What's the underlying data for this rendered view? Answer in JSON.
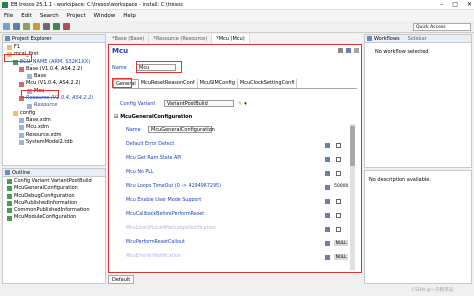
{
  "window": {
    "title": "EB tresos 25.1.1 - workspace: C:\\tresos\\workspace - install: C:\\tresos",
    "min": "–",
    "max": "□",
    "close": "✕"
  },
  "menu": [
    "File",
    "Edit",
    "Search",
    "Project",
    "Window",
    "Help"
  ],
  "quick_access": "Quick Access",
  "project_explorer": {
    "tab": "Project Explorer",
    "items": [
      {
        "label": "F1"
      },
      {
        "label": "mcal_first"
      },
      {
        "label": "ECU_NAME (ARM, S32K1XX)"
      },
      {
        "label": "Base (V1.0.4, AS4.2.2)"
      },
      {
        "label": "Base"
      },
      {
        "label": "Mcu (V1.0.4, AS4.2.2)"
      },
      {
        "label": "Mcu"
      },
      {
        "label": "Resource (V1.0.4, AS4.2.2)"
      },
      {
        "label": "Resource"
      },
      {
        "label": "config"
      },
      {
        "label": "Base.xdm"
      },
      {
        "label": "Mcu.xdm"
      },
      {
        "label": "Resource.xdm"
      },
      {
        "label": "SystemModel2.tdb"
      }
    ]
  },
  "outline": {
    "tab": "Outline",
    "items": [
      {
        "label": "Config Variant VariantPostBuild"
      },
      {
        "label": "McuGeneralConfiguration"
      },
      {
        "label": "McuDebugConfiguration"
      },
      {
        "label": "McuPublishedInformation"
      },
      {
        "label": "CommonPublishedInformation"
      },
      {
        "label": "McuModuleConfiguration"
      }
    ]
  },
  "editor": {
    "tabs": [
      "*Base (Base)",
      "*Resource (Resource)",
      "*Mcu (Mcu)"
    ],
    "title": "Mcu",
    "name_label": "Name",
    "name_value": "Mcu",
    "subtabs": [
      "General",
      "McuResetReasonConf",
      "McuSIMConfig",
      "McuClockSettingConfi"
    ],
    "config_variant_label": "Config Variant",
    "config_variant_value": "VariantPostBuild",
    "section": "McuGeneralConfiguration",
    "section_name_value": "McuGeneralConfiguration",
    "params": [
      {
        "label": "Default Error Detect",
        "value": ""
      },
      {
        "label": "Mcu Get Ram State API",
        "value": ""
      },
      {
        "label": "Mcu No PLL",
        "value": ""
      },
      {
        "label": "Mcu Loops TimeOut (0 -> 4294967295)",
        "value": "50000"
      },
      {
        "label": "Mcu Enable User Mode Support",
        "value": ""
      },
      {
        "label": "McuCallbackBeforePerformReset",
        "value": ""
      },
      {
        "label": "McuLossOfLockAfterLoopsNotification",
        "value": ""
      },
      {
        "label": "McuPerformResetCallout",
        "value": "NULL"
      },
      {
        "label": "McuErrorIsrNotification",
        "value": "NULL"
      }
    ],
    "bottom_tab": "Default"
  },
  "workflows": {
    "tab": "Workflows",
    "tab2": "Sidebar",
    "message": "No workflow selected."
  },
  "description": {
    "message": "No description available."
  },
  "watermark": "CSDN @一只程序员"
}
